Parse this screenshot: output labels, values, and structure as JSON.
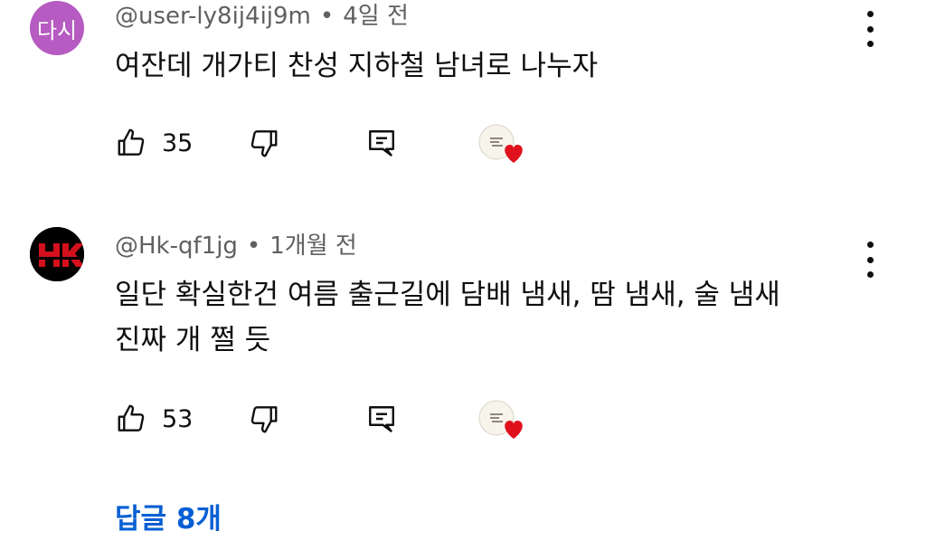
{
  "comments": [
    {
      "avatar_text": "다시",
      "avatar_color": "#b65bc2",
      "author": "@user-ly8ij4ij9m",
      "time": "4일 전",
      "lines": [
        "여잔데 개가티 찬성 지하철 남녀로 나누자"
      ],
      "likes": "35",
      "icons": [
        "thumbs-up-icon",
        "thumbs-down-icon",
        "reply-icon",
        "creator-heart-icon",
        "more-vert-icon"
      ]
    },
    {
      "avatar_logo": "hk-logo",
      "author": "@Hk-qf1jg",
      "time": "1개월 전",
      "lines": [
        "일단 확실한건 여름 출근길에 담배 냄새, 땀 냄새, 술 냄새",
        "진짜 개 쩔 듯"
      ],
      "likes": "53",
      "icons": [
        "thumbs-up-icon",
        "thumbs-down-icon",
        "reply-icon",
        "creator-heart-icon",
        "more-vert-icon"
      ]
    }
  ],
  "replies_label": "답글 8개",
  "colors": {
    "meta": "#606060",
    "text": "#0f0f0f",
    "link": "#065fd4",
    "heart": "#e0101d"
  }
}
